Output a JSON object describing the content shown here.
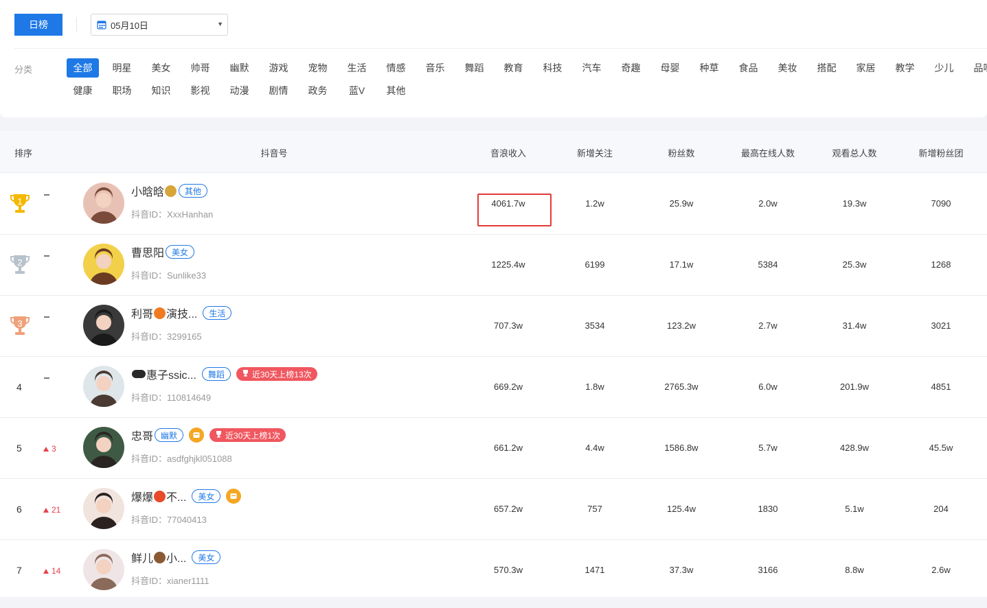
{
  "toolbar": {
    "daily_label": "日榜",
    "date_value": "05月10日"
  },
  "categories": {
    "label": "分类",
    "row1": [
      "全部",
      "明星",
      "美女",
      "帅哥",
      "幽默",
      "游戏",
      "宠物",
      "生活",
      "情感",
      "音乐",
      "舞蹈",
      "教育",
      "科技",
      "汽车",
      "奇趣",
      "母婴",
      "种草",
      "食品",
      "美妆",
      "搭配",
      "家居",
      "教学",
      "少儿",
      "品味"
    ],
    "row2": [
      "健康",
      "职场",
      "知识",
      "影视",
      "动漫",
      "剧情",
      "政务",
      "蓝V",
      "其他"
    ],
    "active": "全部"
  },
  "table": {
    "headers": {
      "rank": "排序",
      "account": "抖音号",
      "income": "音浪收入",
      "new_follow": "新增关注",
      "fans": "粉丝数",
      "peak_online": "最高在线人数",
      "total_viewers": "观看总人数",
      "new_fan_club": "新增粉丝团"
    },
    "id_prefix": "抖音ID：",
    "rows": [
      {
        "rank": "1",
        "change": "",
        "name": "小晗晗",
        "tag": "其他",
        "badge": "",
        "shop": false,
        "id": "XxxHanhan",
        "income": "4061.7w",
        "new_follow": "1.2w",
        "fans": "25.9w",
        "peak_online": "2.0w",
        "total_viewers": "19.3w",
        "new_fan_club": "7090"
      },
      {
        "rank": "2",
        "change": "",
        "name": "曹思阳",
        "tag": "美女",
        "badge": "",
        "shop": false,
        "id": "Sunlike33",
        "income": "1225.4w",
        "new_follow": "6199",
        "fans": "17.1w",
        "peak_online": "5384",
        "total_viewers": "25.3w",
        "new_fan_club": "1268"
      },
      {
        "rank": "3",
        "change": "",
        "name": "利哥",
        "name_suffix": "演技...",
        "tag": "生活",
        "badge": "",
        "shop": false,
        "id": "3299165",
        "income": "707.3w",
        "new_follow": "3534",
        "fans": "123.2w",
        "peak_online": "2.7w",
        "total_viewers": "31.4w",
        "new_fan_club": "3021"
      },
      {
        "rank": "4",
        "change": "",
        "name": "惠子ssic...",
        "tag": "舞蹈",
        "badge": "近30天上榜13次",
        "shop": false,
        "id": "110814649",
        "income": "669.2w",
        "new_follow": "1.8w",
        "fans": "2765.3w",
        "peak_online": "6.0w",
        "total_viewers": "201.9w",
        "new_fan_club": "4851"
      },
      {
        "rank": "5",
        "change": "3",
        "name": "忠哥",
        "tag": "幽默",
        "badge": "近30天上榜1次",
        "shop": true,
        "id": "asdfghjkl051088",
        "income": "661.2w",
        "new_follow": "4.4w",
        "fans": "1586.8w",
        "peak_online": "5.7w",
        "total_viewers": "428.9w",
        "new_fan_club": "45.5w"
      },
      {
        "rank": "6",
        "change": "21",
        "name": "爆爆",
        "name_suffix": "不...",
        "tag": "美女",
        "badge": "",
        "shop": true,
        "id": "77040413",
        "income": "657.2w",
        "new_follow": "757",
        "fans": "125.4w",
        "peak_online": "1830",
        "total_viewers": "5.1w",
        "new_fan_club": "204"
      },
      {
        "rank": "7",
        "change": "14",
        "name": "鲜儿",
        "name_suffix": "小...",
        "tag": "美女",
        "badge": "",
        "shop": false,
        "id": "xianer1111",
        "income": "570.3w",
        "new_follow": "1471",
        "fans": "37.3w",
        "peak_online": "3166",
        "total_viewers": "8.8w",
        "new_fan_club": "2.6w"
      }
    ]
  },
  "colors": {
    "primary": "#1e78e6",
    "gold": "#f5b800",
    "silver": "#b8c2cc",
    "bronze": "#f0a07a",
    "up": "#e8404a",
    "badge": "#f0575f",
    "highlight": "#e53935"
  }
}
